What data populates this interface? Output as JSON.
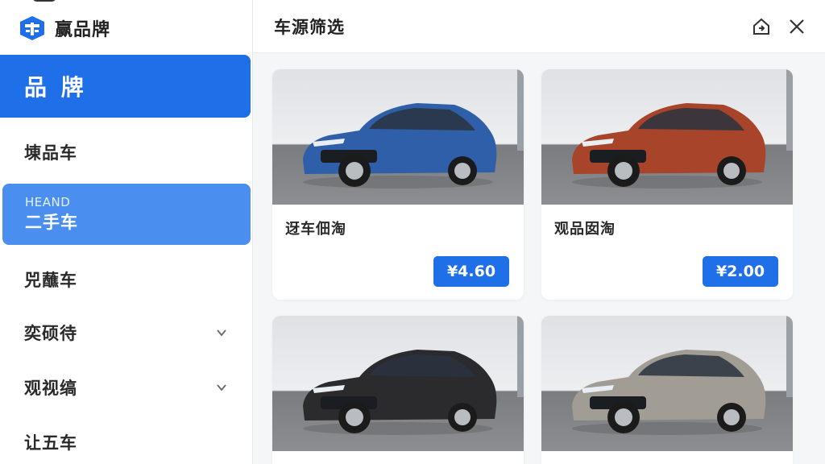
{
  "app": {
    "logo_text": "赢品牌"
  },
  "sidebar": {
    "items": [
      {
        "label": "品 牌",
        "active": true
      },
      {
        "label": "埬品车"
      },
      {
        "sub": "HEAND",
        "label": "二手车",
        "highlight": true
      },
      {
        "label": "兕蘸车"
      },
      {
        "label": "奕硕待",
        "expandable": true
      },
      {
        "label": "观视缟",
        "expandable": true
      },
      {
        "label": "让五车"
      }
    ]
  },
  "header": {
    "title": "车源筛选"
  },
  "cards": [
    {
      "name": "迓车佃淘",
      "price": "¥4.60",
      "color": "#2f5fa8"
    },
    {
      "name": "观品囡淘",
      "price": "¥2.00",
      "color": "#a8442a"
    },
    {
      "name": "",
      "price": "",
      "color": "#2b2b2d"
    },
    {
      "name": "",
      "price": "",
      "color": "#a19d95"
    }
  ],
  "colors": {
    "accent": "#1f6fe8",
    "accent_light": "#4a8ff0"
  },
  "icons": {
    "logo": "brand-logo-icon",
    "export": "home-share-icon",
    "close": "close-icon",
    "expand": "chevron-down-icon"
  }
}
